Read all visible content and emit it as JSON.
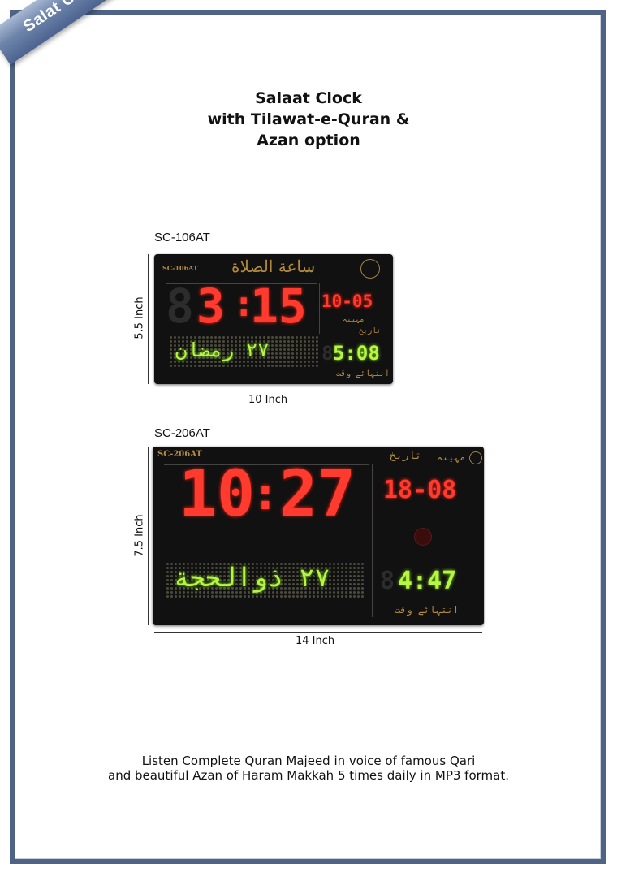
{
  "ribbon": {
    "label": "Salat Clocks"
  },
  "header": {
    "line1": "Salaat Clock",
    "line2": "with Tilawat-e-Quran &",
    "line3": "Azan option"
  },
  "products": [
    {
      "model": "SC-106AT",
      "height_label": "5.5 Inch",
      "width_label": "10 Inch",
      "display": {
        "model_tag": "SC-106AT",
        "top_text": "ساعة الصلاة",
        "time_hour": "3",
        "time_hour_ghost": "8",
        "time_min": "15",
        "date": "10-05",
        "month_label": "مہینہ",
        "date_label": "تاریخ",
        "scroll_text": "٢٧ رمضان",
        "prayer_time": "5:08",
        "end_label": "انتہائے وقت"
      }
    },
    {
      "model": "SC-206AT",
      "height_label": "7.5 Inch",
      "width_label": "14 Inch",
      "display": {
        "model_tag": "SC-206AT",
        "date_label": "تاریخ",
        "month_label": "مہینہ",
        "time_hour": "10",
        "time_min": "27",
        "date": "18-08",
        "scroll_text": "٢٧ ذوالحجة",
        "prayer_time": "4:47",
        "end_label": "انتہائے وقت"
      }
    }
  ],
  "footer": {
    "line1": "Listen Complete Quran Majeed in voice of famous Qari",
    "line2": "and beautiful Azan of Haram Makkah 5 times daily in MP3 format."
  }
}
